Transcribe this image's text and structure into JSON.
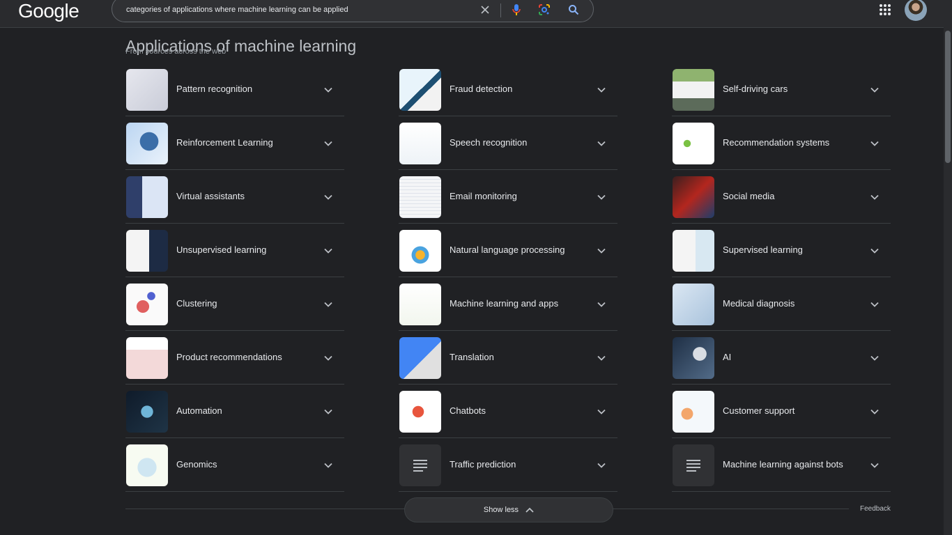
{
  "header": {
    "logo": "Google",
    "search_query": "categories of applications where machine learning can be applied"
  },
  "section": {
    "title": "Applications of machine learning",
    "subtitle": "From sources across the web"
  },
  "columns": [
    [
      {
        "label": "Pattern recognition",
        "thumb": "pattern-recognition"
      },
      {
        "label": "Reinforcement Learning",
        "thumb": "reinforcement-learning"
      },
      {
        "label": "Virtual assistants",
        "thumb": "virtual-assistants"
      },
      {
        "label": "Unsupervised learning",
        "thumb": "unsupervised-learning"
      },
      {
        "label": "Clustering",
        "thumb": "clustering"
      },
      {
        "label": "Product recommendations",
        "thumb": "product-recommendations"
      },
      {
        "label": "Automation",
        "thumb": "automation"
      },
      {
        "label": "Genomics",
        "thumb": "genomics"
      }
    ],
    [
      {
        "label": "Fraud detection",
        "thumb": "fraud-detection"
      },
      {
        "label": "Speech recognition",
        "thumb": "speech-recognition"
      },
      {
        "label": "Email monitoring",
        "thumb": "email-monitoring"
      },
      {
        "label": "Natural language processing",
        "thumb": "nlp"
      },
      {
        "label": "Machine learning and apps",
        "thumb": "ml-apps"
      },
      {
        "label": "Translation",
        "thumb": "translation"
      },
      {
        "label": "Chatbots",
        "thumb": "chatbots"
      },
      {
        "label": "Traffic prediction",
        "thumb": "document-icon"
      }
    ],
    [
      {
        "label": "Self-driving cars",
        "thumb": "self-driving-cars"
      },
      {
        "label": "Recommendation systems",
        "thumb": "recommendation-systems"
      },
      {
        "label": "Social media",
        "thumb": "social-media"
      },
      {
        "label": "Supervised learning",
        "thumb": "supervised-learning"
      },
      {
        "label": "Medical diagnosis",
        "thumb": "medical-diagnosis"
      },
      {
        "label": "AI",
        "thumb": "ai"
      },
      {
        "label": "Customer support",
        "thumb": "customer-support"
      },
      {
        "label": "Machine learning against bots",
        "thumb": "document-icon"
      }
    ]
  ],
  "footer": {
    "show_less_label": "Show less",
    "feedback_label": "Feedback"
  }
}
